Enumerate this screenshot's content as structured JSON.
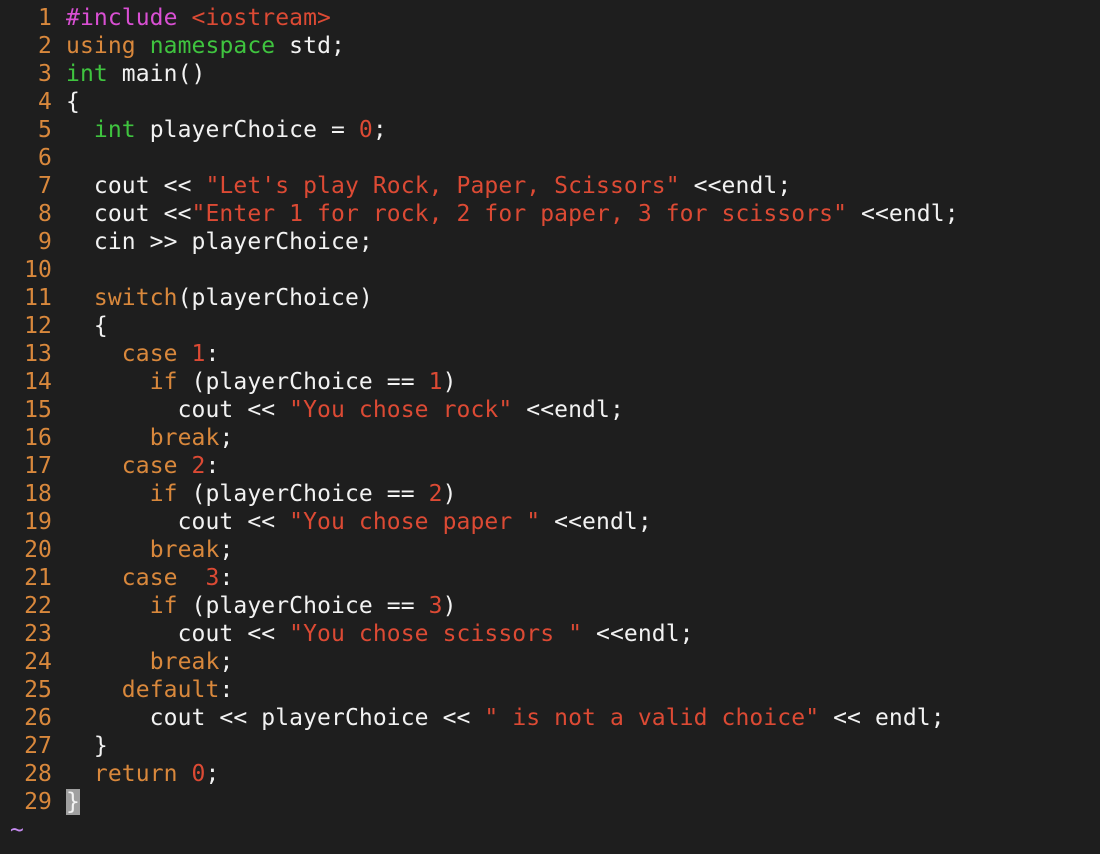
{
  "editor": {
    "colors": {
      "background": "#1e1e1e",
      "line_number": "#d9883c",
      "keyword": "#d9883c",
      "type": "#3fc43f",
      "preprocessor": "#d94fd3",
      "string": "#dc4a34",
      "plain": "#f2f2f2",
      "empty_line_marker": "#c58bf0"
    },
    "lines": [
      {
        "n": "1",
        "tokens": [
          [
            "pre",
            "#include"
          ],
          [
            "plain",
            " "
          ],
          [
            "str",
            "<iostream>"
          ]
        ]
      },
      {
        "n": "2",
        "tokens": [
          [
            "kw",
            "using"
          ],
          [
            "plain",
            " "
          ],
          [
            "type",
            "namespace"
          ],
          [
            "plain",
            " std;"
          ]
        ]
      },
      {
        "n": "3",
        "tokens": [
          [
            "type",
            "int"
          ],
          [
            "plain",
            " main()"
          ]
        ]
      },
      {
        "n": "4",
        "tokens": [
          [
            "plain",
            "{"
          ]
        ]
      },
      {
        "n": "5",
        "tokens": [
          [
            "plain",
            "  "
          ],
          [
            "type",
            "int"
          ],
          [
            "plain",
            " playerChoice = "
          ],
          [
            "num",
            "0"
          ],
          [
            "plain",
            ";"
          ]
        ]
      },
      {
        "n": "6",
        "tokens": []
      },
      {
        "n": "7",
        "tokens": [
          [
            "plain",
            "  cout << "
          ],
          [
            "str",
            "\"Let's play Rock, Paper, Scissors\""
          ],
          [
            "plain",
            " <<endl;"
          ]
        ]
      },
      {
        "n": "8",
        "tokens": [
          [
            "plain",
            "  cout <<"
          ],
          [
            "str",
            "\"Enter 1 for rock, 2 for paper, 3 for scissors\""
          ],
          [
            "plain",
            " <<endl;"
          ]
        ]
      },
      {
        "n": "9",
        "tokens": [
          [
            "plain",
            "  cin >> playerChoice;"
          ]
        ]
      },
      {
        "n": "10",
        "tokens": []
      },
      {
        "n": "11",
        "tokens": [
          [
            "plain",
            "  "
          ],
          [
            "kw",
            "switch"
          ],
          [
            "plain",
            "(playerChoice)"
          ]
        ]
      },
      {
        "n": "12",
        "tokens": [
          [
            "plain",
            "  {"
          ]
        ]
      },
      {
        "n": "13",
        "tokens": [
          [
            "plain",
            "    "
          ],
          [
            "kw",
            "case"
          ],
          [
            "plain",
            " "
          ],
          [
            "num",
            "1"
          ],
          [
            "plain",
            ":"
          ]
        ]
      },
      {
        "n": "14",
        "tokens": [
          [
            "plain",
            "      "
          ],
          [
            "kw",
            "if"
          ],
          [
            "plain",
            " (playerChoice == "
          ],
          [
            "num",
            "1"
          ],
          [
            "plain",
            ")"
          ]
        ]
      },
      {
        "n": "15",
        "tokens": [
          [
            "plain",
            "        cout << "
          ],
          [
            "str",
            "\"You chose rock\""
          ],
          [
            "plain",
            " <<endl;"
          ]
        ]
      },
      {
        "n": "16",
        "tokens": [
          [
            "plain",
            "      "
          ],
          [
            "kw",
            "break"
          ],
          [
            "plain",
            ";"
          ]
        ]
      },
      {
        "n": "17",
        "tokens": [
          [
            "plain",
            "    "
          ],
          [
            "kw",
            "case"
          ],
          [
            "plain",
            " "
          ],
          [
            "num",
            "2"
          ],
          [
            "plain",
            ":"
          ]
        ]
      },
      {
        "n": "18",
        "tokens": [
          [
            "plain",
            "      "
          ],
          [
            "kw",
            "if"
          ],
          [
            "plain",
            " (playerChoice == "
          ],
          [
            "num",
            "2"
          ],
          [
            "plain",
            ")"
          ]
        ]
      },
      {
        "n": "19",
        "tokens": [
          [
            "plain",
            "        cout << "
          ],
          [
            "str",
            "\"You chose paper \""
          ],
          [
            "plain",
            " <<endl;"
          ]
        ]
      },
      {
        "n": "20",
        "tokens": [
          [
            "plain",
            "      "
          ],
          [
            "kw",
            "break"
          ],
          [
            "plain",
            ";"
          ]
        ]
      },
      {
        "n": "21",
        "tokens": [
          [
            "plain",
            "    "
          ],
          [
            "kw",
            "case"
          ],
          [
            "plain",
            "  "
          ],
          [
            "num",
            "3"
          ],
          [
            "plain",
            ":"
          ]
        ]
      },
      {
        "n": "22",
        "tokens": [
          [
            "plain",
            "      "
          ],
          [
            "kw",
            "if"
          ],
          [
            "plain",
            " (playerChoice == "
          ],
          [
            "num",
            "3"
          ],
          [
            "plain",
            ")"
          ]
        ]
      },
      {
        "n": "23",
        "tokens": [
          [
            "plain",
            "        cout << "
          ],
          [
            "str",
            "\"You chose scissors \""
          ],
          [
            "plain",
            " <<endl;"
          ]
        ]
      },
      {
        "n": "24",
        "tokens": [
          [
            "plain",
            "      "
          ],
          [
            "kw",
            "break"
          ],
          [
            "plain",
            ";"
          ]
        ]
      },
      {
        "n": "25",
        "tokens": [
          [
            "plain",
            "    "
          ],
          [
            "kw",
            "default"
          ],
          [
            "plain",
            ":"
          ]
        ]
      },
      {
        "n": "26",
        "tokens": [
          [
            "plain",
            "      cout << playerChoice << "
          ],
          [
            "str",
            "\" is not a valid choice\""
          ],
          [
            "plain",
            " << endl;"
          ]
        ]
      },
      {
        "n": "27",
        "tokens": [
          [
            "plain",
            "  }"
          ]
        ]
      },
      {
        "n": "28",
        "tokens": [
          [
            "plain",
            "  "
          ],
          [
            "kw",
            "return"
          ],
          [
            "plain",
            " "
          ],
          [
            "num",
            "0"
          ],
          [
            "plain",
            ";"
          ]
        ]
      },
      {
        "n": "29",
        "tokens": [
          [
            "cursor",
            "}"
          ]
        ]
      }
    ],
    "empty_line_marker": "~"
  }
}
